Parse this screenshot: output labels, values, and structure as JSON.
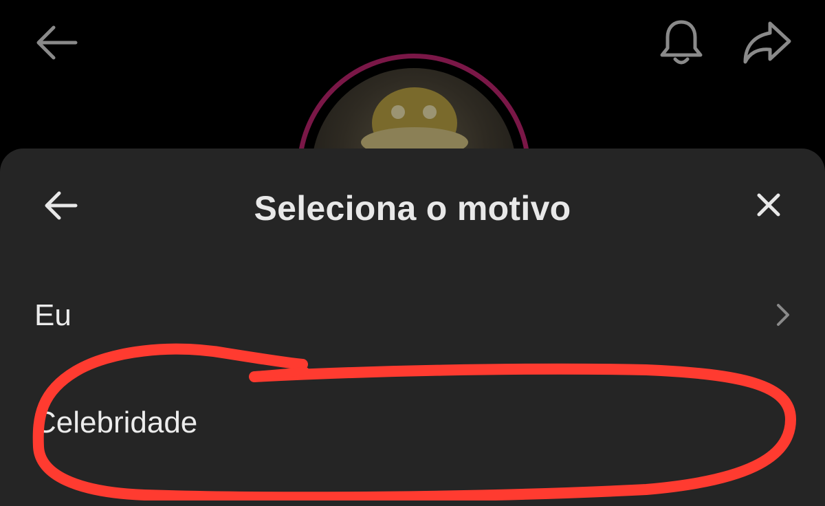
{
  "header": {
    "back_icon": "back-arrow-icon",
    "bell_icon": "bell-icon",
    "share_icon": "share-icon"
  },
  "profile": {
    "avatar_ring_color": "#7a1747"
  },
  "sheet": {
    "title": "Seleciona o motivo",
    "back_icon": "back-arrow-icon",
    "close_icon": "close-icon",
    "options": [
      {
        "label": "Eu",
        "has_chevron": true
      },
      {
        "label": "Celebridade",
        "has_chevron": false
      }
    ]
  },
  "annotation": {
    "color": "#ff3b30",
    "target": "Celebridade"
  }
}
